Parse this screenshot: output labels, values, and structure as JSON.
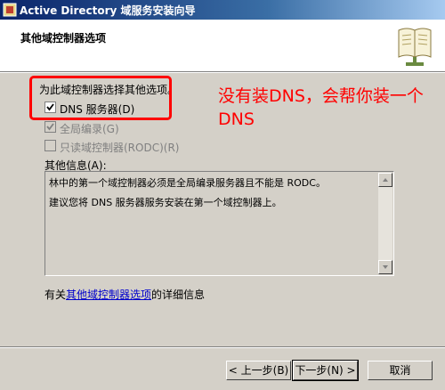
{
  "window": {
    "title": "Active Directory 域服务安装向导"
  },
  "header": {
    "heading": "其他域控制器选项"
  },
  "options": {
    "prompt": "为此域控制器选择其他选项。",
    "items": [
      {
        "label": "DNS 服务器(D)",
        "checked": true,
        "enabled": true
      },
      {
        "label": "全局编录(G)",
        "checked": true,
        "enabled": false
      },
      {
        "label": "只读域控制器(RODC)(R)",
        "checked": false,
        "enabled": false
      }
    ]
  },
  "annotation": {
    "text": "没有装DNS，会帮你装一个DNS",
    "color": "#ff0000"
  },
  "info": {
    "label": "其他信息(A):",
    "lines": [
      "林中的第一个域控制器必须是全局编录服务器且不能是 RODC。",
      "建议您将 DNS 服务器服务安装在第一个域控制器上。"
    ]
  },
  "more_info": {
    "prefix": "有关",
    "link": "其他域控制器选项",
    "suffix": "的详细信息"
  },
  "buttons": {
    "back": "< 上一步(B)",
    "next": "下一步(N) >",
    "cancel": "取消"
  }
}
